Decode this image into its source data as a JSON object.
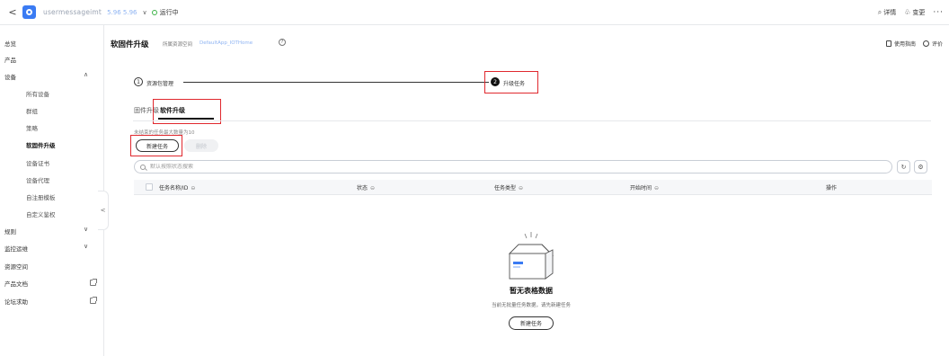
{
  "topbar": {
    "back": "<",
    "instance_name": "usermessageimt",
    "instance_id": "5.96 5.96",
    "status": "运行中",
    "actions": [
      {
        "icon": "detail-icon",
        "label": "详情"
      },
      {
        "icon": "change-icon",
        "label": "变更"
      }
    ],
    "more": "···"
  },
  "sidebar": {
    "items": [
      {
        "label": "总览",
        "type": "top"
      },
      {
        "label": "产品",
        "type": "top"
      },
      {
        "label": "设备",
        "type": "top",
        "expandable": true,
        "expanded": true
      },
      {
        "label": "所有设备",
        "type": "sub"
      },
      {
        "label": "群组",
        "type": "sub"
      },
      {
        "label": "策略",
        "type": "sub"
      },
      {
        "label": "软固件升级",
        "type": "sub",
        "active": true
      },
      {
        "label": "设备证书",
        "type": "sub"
      },
      {
        "label": "设备代理",
        "type": "sub"
      },
      {
        "label": "自注册模板",
        "type": "sub"
      },
      {
        "label": "自定义鉴权",
        "type": "sub"
      },
      {
        "label": "规则",
        "type": "top",
        "expandable": true
      },
      {
        "label": "监控运维",
        "type": "top",
        "expandable": true
      },
      {
        "label": "资源空间",
        "type": "top"
      },
      {
        "label": "产品文档",
        "type": "top",
        "external": true
      },
      {
        "label": "论坛求助",
        "type": "top",
        "external": true
      }
    ],
    "collapse": "<"
  },
  "header": {
    "title": "软固件升级",
    "namespace_label": "所属资源空间",
    "namespace_value": "DefaultApp_IOTHome",
    "help": "?",
    "guide_link": "使用指南",
    "rate_link": "评价"
  },
  "steps": [
    {
      "num": "1",
      "label": "资源包管理"
    },
    {
      "num": "2",
      "label": "升级任务"
    }
  ],
  "tabs": [
    {
      "label": "固件升级"
    },
    {
      "label": "软件升级"
    }
  ],
  "toolbar": {
    "limit_note": "未结束的任务最大数量为10",
    "create_label": "新建任务",
    "delete_label": "删除"
  },
  "search": {
    "placeholder": "默认按照状态搜索"
  },
  "table": {
    "columns": [
      "任务名称/ID",
      "状态",
      "任务类型",
      "开始时间",
      "操作"
    ]
  },
  "empty": {
    "title": "暂无表格数据",
    "desc": "当前无批量任务数据，请先新建任务",
    "button": "新建任务"
  },
  "colors": {
    "accent": "#3a7bf3",
    "highlight": "#e0282e",
    "status_running": "#3bb346"
  }
}
